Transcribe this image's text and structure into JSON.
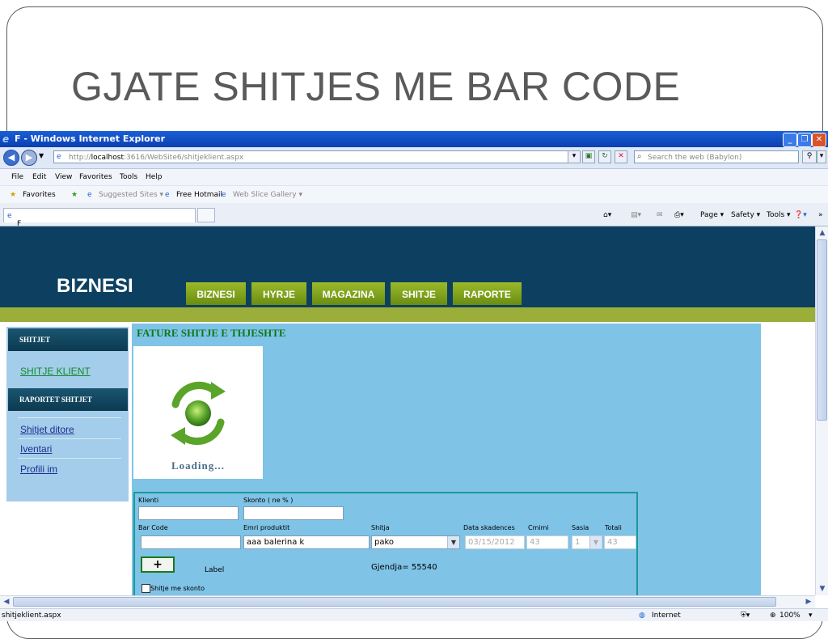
{
  "slide": {
    "title": "GJATE SHITJES ME BAR CODE"
  },
  "browser": {
    "window_title": "F - Windows Internet Explorer",
    "url_prefix": "http://",
    "url_host": "localhost",
    "url_rest": ":3616/WebSite6/shitjeklient.aspx",
    "search_placeholder": "Search the web (Babylon)",
    "menu": [
      "File",
      "Edit",
      "View",
      "Favorites",
      "Tools",
      "Help"
    ],
    "favorites_label": "Favorites",
    "fav_items": [
      "Suggested Sites ▾",
      "Free Hotmail",
      "Web Slice Gallery ▾"
    ],
    "tab_title": "F",
    "cmd": {
      "page": "Page ▾",
      "safety": "Safety ▾",
      "tools": "Tools ▾",
      "more": "»"
    },
    "status_url": "shitjeklient.aspx",
    "status_zone": "Internet",
    "zoom": "100%"
  },
  "site": {
    "logo": "BIZNESI",
    "nav": [
      "BIZNESI",
      "HYRJE",
      "MAGAZINA",
      "SHITJE",
      "RAPORTE"
    ],
    "sidebar": {
      "head1": "SHITJET",
      "link_klient": "SHITJE KLIENT",
      "head2": "RAPORTET SHITJET",
      "links": [
        "Shitjet ditore",
        "Iventari",
        "Profili im"
      ]
    },
    "main_title": "FATURE SHITJE E THJESHTE",
    "loading_text": "Loading...",
    "form": {
      "klienti_label": "Klienti",
      "skonto_label": "Skonto ( ne % )",
      "barcode_label": "Bar Code",
      "emri_label": "Emri produktit",
      "shitja_label": "Shitja",
      "data_label": "Data skadences",
      "cmimi_label": "Cmimi",
      "sasia_label": "Sasia",
      "totali_label": "Totali",
      "emri_value": "aaa balerina k",
      "shitja_value": "pako",
      "data_value": "03/15/2012",
      "cmimi_value": "43",
      "sasia_value": "1",
      "totali_value": "43",
      "add_label": "+",
      "label_text": "Label",
      "gjendja": "Gjendja= 55540",
      "checkbox_label": "Shitje me skonto"
    }
  },
  "colors": {
    "header": "#0d4060",
    "nav_green": "#7fa01c",
    "band": "#9bae3a",
    "main_bg": "#7fc3e6",
    "sidebar_bg": "#a3cdea",
    "title_green": "#0b7a1a"
  }
}
